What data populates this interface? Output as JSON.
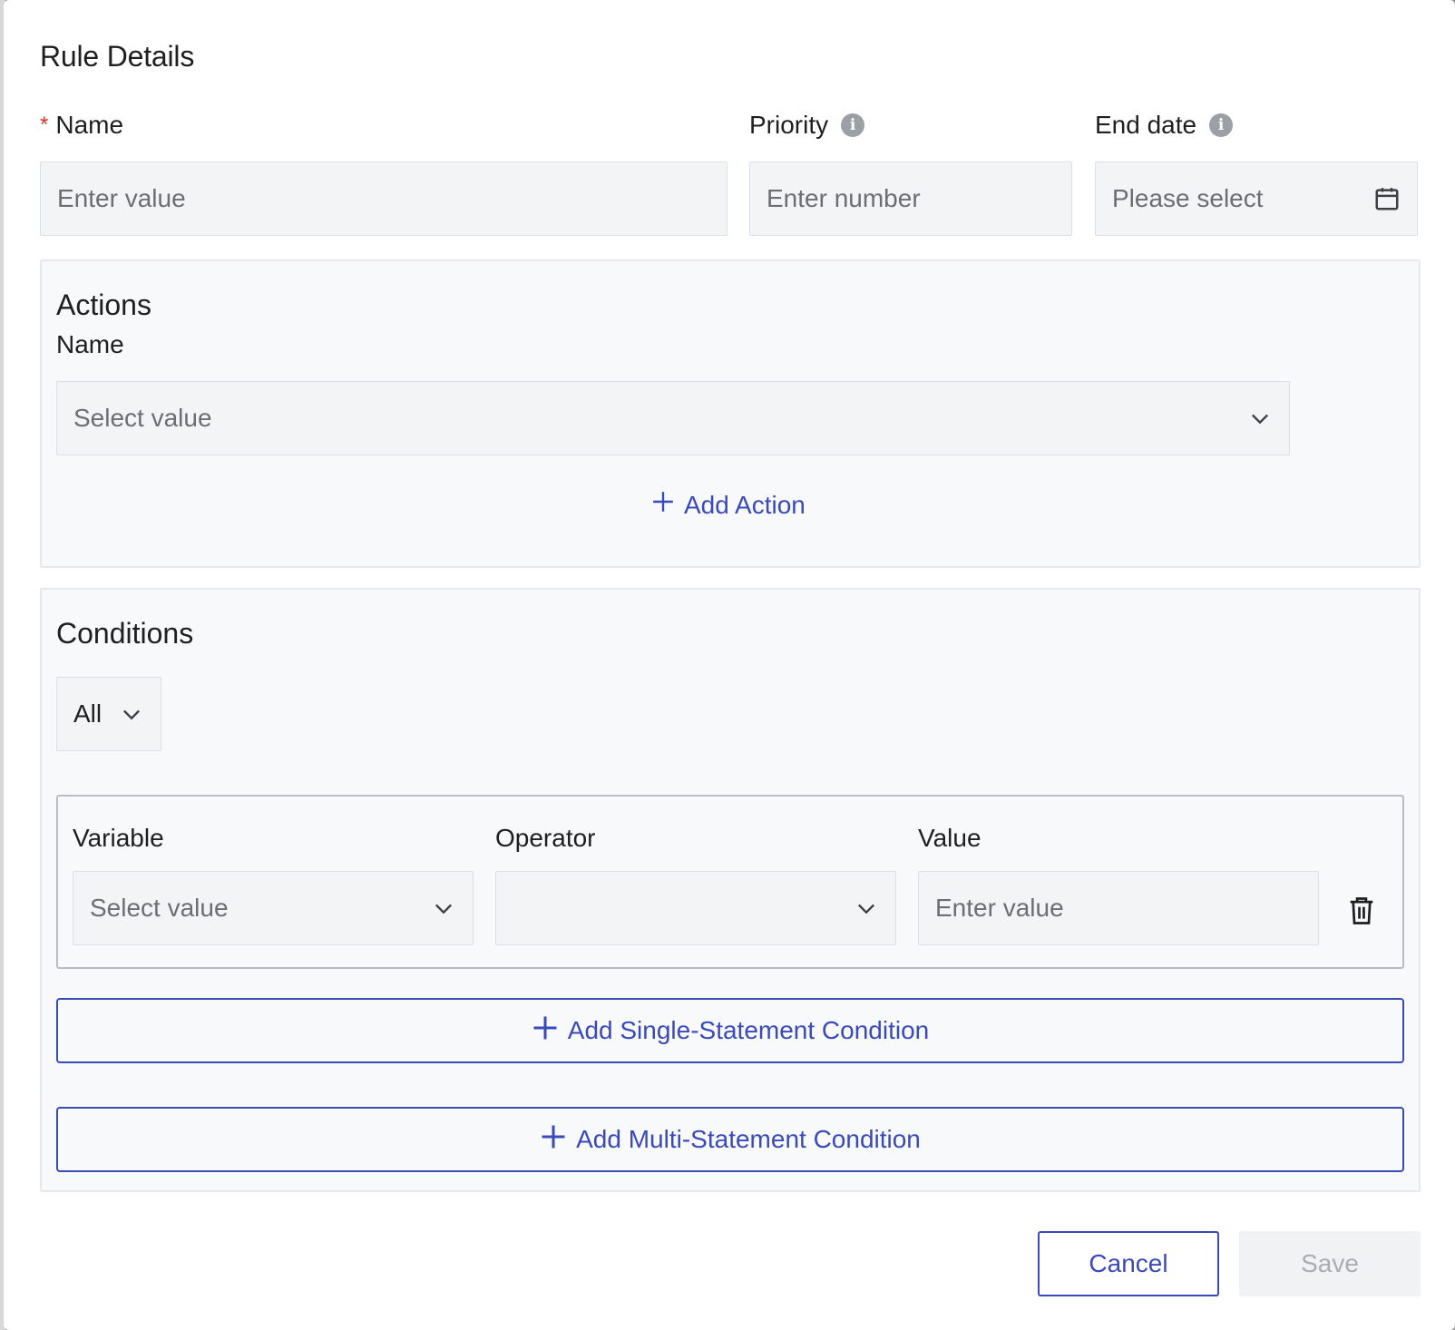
{
  "modal": {
    "title": "Rule Details"
  },
  "fields": {
    "name": {
      "label": "Name",
      "required_mark": "*",
      "placeholder": "Enter value"
    },
    "priority": {
      "label": "Priority",
      "placeholder": "Enter number"
    },
    "end_date": {
      "label": "End date",
      "placeholder": "Please select"
    }
  },
  "actions": {
    "title": "Actions",
    "name_label": "Name",
    "select_placeholder": "Select value",
    "add_label": "Add Action"
  },
  "conditions": {
    "title": "Conditions",
    "match_mode": "All",
    "row": {
      "variable_label": "Variable",
      "variable_placeholder": "Select value",
      "operator_label": "Operator",
      "operator_value": "",
      "value_label": "Value",
      "value_placeholder": "Enter value"
    },
    "add_single_label": "Add Single-Statement Condition",
    "add_multi_label": "Add Multi-Statement Condition"
  },
  "footer": {
    "cancel_label": "Cancel",
    "save_label": "Save"
  },
  "icons": {
    "info": "info-icon",
    "calendar": "calendar-icon",
    "chevron": "chevron-down-icon",
    "plus": "plus-icon",
    "trash": "trash-icon"
  },
  "colors": {
    "accent": "#3a4ab8",
    "required": "#d93025",
    "input_bg": "#f3f4f5",
    "panel_bg": "#f8f9fa"
  }
}
